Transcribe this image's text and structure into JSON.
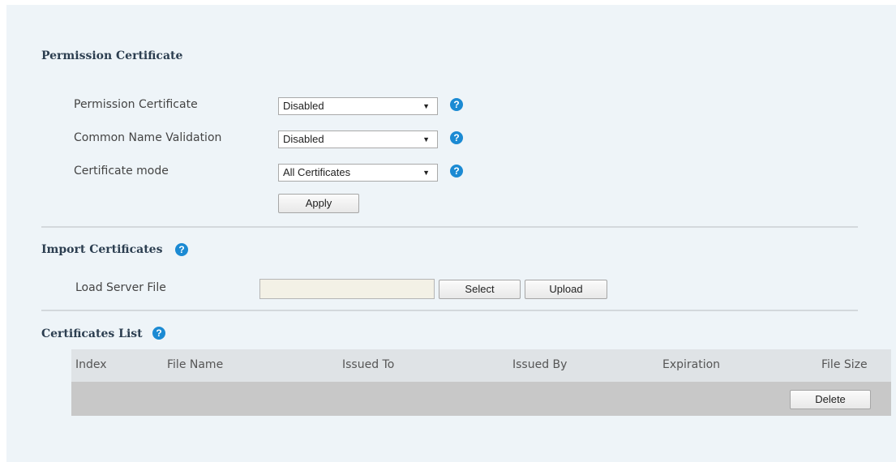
{
  "permission_section": {
    "title": "Permission Certificate",
    "fields": [
      {
        "label": "Permission Certificate",
        "value": "Disabled"
      },
      {
        "label": "Common Name Validation",
        "value": "Disabled"
      },
      {
        "label": "Certificate mode",
        "value": "All Certificates"
      }
    ],
    "apply_label": "Apply"
  },
  "import_section": {
    "title": "Import Certificates",
    "load_label": "Load Server File",
    "file_value": "",
    "select_label": "Select",
    "upload_label": "Upload"
  },
  "list_section": {
    "title": "Certificates List",
    "columns": [
      "Index",
      "File Name",
      "Issued To",
      "Issued By",
      "Expiration",
      "File Size"
    ],
    "delete_label": "Delete"
  },
  "colors": {
    "panel_bg": "#eef4f8",
    "help_icon": "#1b8ad3",
    "table_header_bg": "#dfe3e6",
    "table_row_bg": "#c8c8c8"
  },
  "icons": {
    "help": "question-circle-icon",
    "dropdown": "triangle-down-icon"
  }
}
